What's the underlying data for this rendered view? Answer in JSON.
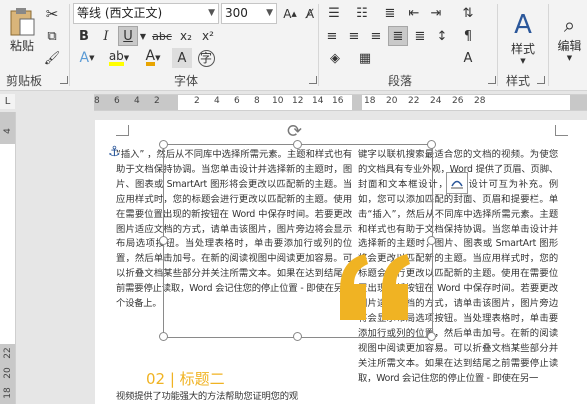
{
  "ribbon": {
    "clipboard": {
      "paste_label": "粘贴",
      "group_label": "剪贴板"
    },
    "font": {
      "font_name": "等线 (西文正文)",
      "font_size": "300",
      "group_label": "字体",
      "bold": "B",
      "italic": "I",
      "underline": "U",
      "strike": "abc",
      "subscript": "x₂",
      "superscript": "x²",
      "highlight_color": "#ffff00",
      "font_color": "#e8a400"
    },
    "paragraph": {
      "group_label": "段落"
    },
    "styles": {
      "label": "样式",
      "group_label": "样式"
    },
    "editing": {
      "label": "编辑"
    }
  },
  "ruler": {
    "horizontal_ticks": [
      "8",
      "6",
      "4",
      "2",
      "",
      "2",
      "4",
      "6",
      "8",
      "10",
      "12",
      "14",
      "16",
      "18",
      "20",
      "22",
      "24",
      "26",
      "28"
    ],
    "vertical_ticks": [
      "4",
      "2",
      "",
      "",
      "",
      "",
      "",
      "",
      "",
      "",
      "",
      "",
      "",
      "",
      "22",
      "20",
      "18"
    ]
  },
  "document": {
    "left_column": "“插入” ，然后从不同库中选择所需元素。主题和样式也有助于文档保持协调。当您单击设计并选择新的主题时，图片、图表或 SmartArt 图形将会更改以匹配新的主题。当应用样式时，您的标题会进行更改以匹配新的主题。使用在需要位置出现的新按钮在 Word 中保存时间。若要更改图片适应文档的方式，请单击该图片，图片旁边将会显示布局选项按钮。当处理表格时，单击要添加行或列的位置，然后单击加号。在新的阅读视图中阅读更加容易。可以折叠文档某些部分并关注所需文本。如果在达到结尾之前需要停止读取，Word 会记住您的停止位置 - 即使在另一个设备上。",
    "right_column": "键字以联机搜索最适合您的文档的视频。为使您的文档具有专业外观，Word 提供了页眉、页脚、封面和文本框设计，这些设计可互为补充。例如，您可以添加匹配的封面、页眉和提要栏。单击“插入”，然后从不同库中选择所需元素。主题和样式也有助于文档保持协调。当您单击设计并选择新的主题时，图片、图表或 SmartArt 图形将会更改以匹配新的主题。当应用样式时，您的标题会进行更改以匹配新的主题。使用在需要位置出现的新按钮在 Word 中保存时间。若要更改图片适应文档的方式，请单击该图片，图片旁边将会显示布局选项按钮。当处理表格时，单击要添加行或列的位置，然后单击加号。在新的阅读视图中阅读更加容易。可以折叠文档某些部分并关注所需文本。如果在达到结尾之前需要停止读取，Word 会记住您的停止位置 - 即使在另一",
    "heading": "02 | 标题二",
    "heading_body": "视频提供了功能强大的方法帮助您证明您的观",
    "quote_color": "#f0b323"
  }
}
